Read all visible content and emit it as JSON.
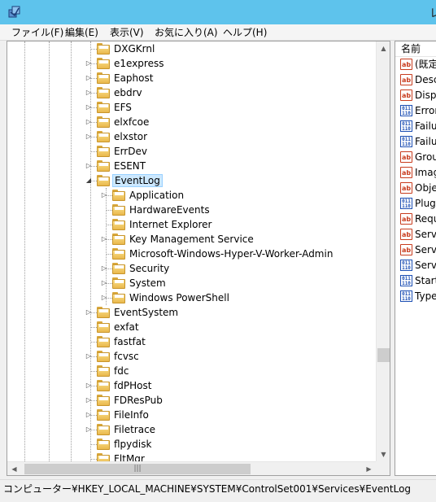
{
  "window": {
    "title": "レ"
  },
  "menu": [
    {
      "label": "ファイル(F)"
    },
    {
      "label": "編集(E)"
    },
    {
      "label": "表示(V)"
    },
    {
      "label": "お気に入り(A)"
    },
    {
      "label": "ヘルプ(H)"
    }
  ],
  "tree": {
    "items": [
      {
        "label": "DXGKrnl",
        "level": 0,
        "expander": ""
      },
      {
        "label": "e1express",
        "level": 0,
        "expander": "collapsed"
      },
      {
        "label": "Eaphost",
        "level": 0,
        "expander": "collapsed"
      },
      {
        "label": "ebdrv",
        "level": 0,
        "expander": "collapsed"
      },
      {
        "label": "EFS",
        "level": 0,
        "expander": "collapsed"
      },
      {
        "label": "elxfcoe",
        "level": 0,
        "expander": "collapsed"
      },
      {
        "label": "elxstor",
        "level": 0,
        "expander": "collapsed"
      },
      {
        "label": "ErrDev",
        "level": 0,
        "expander": ""
      },
      {
        "label": "ESENT",
        "level": 0,
        "expander": "collapsed"
      },
      {
        "label": "EventLog",
        "level": 0,
        "expander": "expanded",
        "selected": true
      },
      {
        "label": "Application",
        "level": 1,
        "expander": "collapsed"
      },
      {
        "label": "HardwareEvents",
        "level": 1,
        "expander": ""
      },
      {
        "label": "Internet Explorer",
        "level": 1,
        "expander": ""
      },
      {
        "label": "Key Management Service",
        "level": 1,
        "expander": "collapsed"
      },
      {
        "label": "Microsoft-Windows-Hyper-V-Worker-Admin",
        "level": 1,
        "expander": ""
      },
      {
        "label": "Security",
        "level": 1,
        "expander": "collapsed"
      },
      {
        "label": "System",
        "level": 1,
        "expander": "collapsed"
      },
      {
        "label": "Windows PowerShell",
        "level": 1,
        "expander": "collapsed"
      },
      {
        "label": "EventSystem",
        "level": 0,
        "expander": "collapsed"
      },
      {
        "label": "exfat",
        "level": 0,
        "expander": ""
      },
      {
        "label": "fastfat",
        "level": 0,
        "expander": ""
      },
      {
        "label": "fcvsc",
        "level": 0,
        "expander": "collapsed"
      },
      {
        "label": "fdc",
        "level": 0,
        "expander": ""
      },
      {
        "label": "fdPHost",
        "level": 0,
        "expander": "collapsed"
      },
      {
        "label": "FDResPub",
        "level": 0,
        "expander": "collapsed"
      },
      {
        "label": "FileInfo",
        "level": 0,
        "expander": "collapsed"
      },
      {
        "label": "Filetrace",
        "level": 0,
        "expander": "collapsed"
      },
      {
        "label": "flpydisk",
        "level": 0,
        "expander": ""
      },
      {
        "label": "FltMgr",
        "level": 0,
        "expander": ""
      }
    ]
  },
  "values": {
    "column_name": "名前",
    "rows": [
      {
        "name": "(既定",
        "type": "ab"
      },
      {
        "name": "Desc",
        "type": "ab"
      },
      {
        "name": "Displ",
        "type": "ab"
      },
      {
        "name": "Error",
        "type": "bin"
      },
      {
        "name": "Failu",
        "type": "bin"
      },
      {
        "name": "Failu",
        "type": "bin"
      },
      {
        "name": "Grou",
        "type": "ab"
      },
      {
        "name": "Imag",
        "type": "ab"
      },
      {
        "name": "Obje",
        "type": "ab"
      },
      {
        "name": "PlugP",
        "type": "bin"
      },
      {
        "name": "Requ",
        "type": "ab"
      },
      {
        "name": "Servi",
        "type": "ab"
      },
      {
        "name": "Servi",
        "type": "ab"
      },
      {
        "name": "Servi",
        "type": "bin"
      },
      {
        "name": "Start",
        "type": "bin"
      },
      {
        "name": "Type",
        "type": "bin"
      }
    ]
  },
  "status": {
    "path": "コンピューター¥HKEY_LOCAL_MACHINE¥SYSTEM¥ControlSet001¥Services¥EventLog"
  }
}
